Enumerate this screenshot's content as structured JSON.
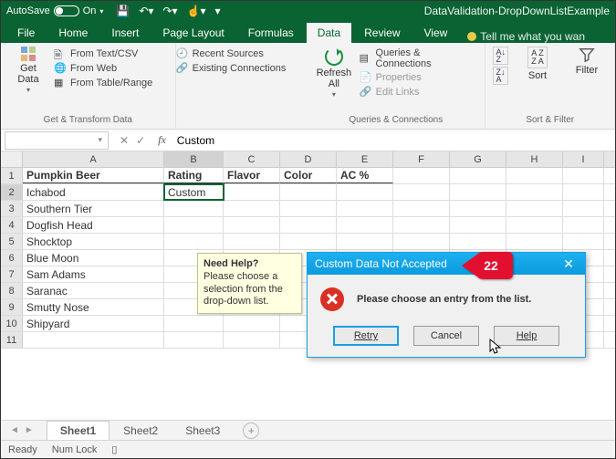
{
  "titlebar": {
    "autosave_label": "AutoSave",
    "autosave_state": "On",
    "doc_title": "DataValidation-DropDownListExample"
  },
  "tabs": {
    "file": "File",
    "home": "Home",
    "insert": "Insert",
    "pagelayout": "Page Layout",
    "formulas": "Formulas",
    "data": "Data",
    "review": "Review",
    "view": "View",
    "tell": "Tell me what you wan"
  },
  "ribbon": {
    "getdata": "Get\nData",
    "from_textcsv": "From Text/CSV",
    "from_web": "From Web",
    "from_table": "From Table/Range",
    "recent_sources": "Recent Sources",
    "existing_conn": "Existing Connections",
    "group1_label": "Get & Transform Data",
    "refresh": "Refresh\nAll",
    "queries": "Queries & Connections",
    "properties": "Properties",
    "editlinks": "Edit Links",
    "group2_label": "Queries & Connections",
    "sort": "Sort",
    "filter": "Filter",
    "group3_label": "Sort & Filter"
  },
  "formula": {
    "namebox": "",
    "fx": "fx",
    "value": "Custom"
  },
  "columns": [
    {
      "k": "A",
      "w": 155
    },
    {
      "k": "B",
      "w": 65
    },
    {
      "k": "C",
      "w": 62
    },
    {
      "k": "D",
      "w": 62
    },
    {
      "k": "E",
      "w": 62
    },
    {
      "k": "F",
      "w": 62
    },
    {
      "k": "G",
      "w": 62
    },
    {
      "k": "H",
      "w": 62
    },
    {
      "k": "I",
      "w": 45
    }
  ],
  "headers": {
    "A": "Pumpkin Beer",
    "B": "Rating",
    "C": "Flavor",
    "D": "Color",
    "E": "AC %"
  },
  "active": {
    "row": 2,
    "col": "B",
    "value": "Custom"
  },
  "rows": [
    {
      "n": 1
    },
    {
      "n": 2,
      "A": "Ichabod",
      "B": "Custom"
    },
    {
      "n": 3,
      "A": "Southern Tier"
    },
    {
      "n": 4,
      "A": "Dogfish Head"
    },
    {
      "n": 5,
      "A": "Shocktop"
    },
    {
      "n": 6,
      "A": "Blue Moon"
    },
    {
      "n": 7,
      "A": "Sam Adams"
    },
    {
      "n": 8,
      "A": "Saranac"
    },
    {
      "n": 9,
      "A": "Smutty Nose"
    },
    {
      "n": 10,
      "A": "Shipyard"
    },
    {
      "n": 11
    }
  ],
  "tip": {
    "title": "Need Help?",
    "body": "Please choose a selection from the drop-down list."
  },
  "dialog": {
    "title": "Custom Data Not Accepted",
    "message": "Please choose an entry from the list.",
    "retry": "Retry",
    "cancel": "Cancel",
    "help": "Help"
  },
  "marker": "22",
  "sheets": {
    "s1": "Sheet1",
    "s2": "Sheet2",
    "s3": "Sheet3"
  },
  "status": {
    "ready": "Ready",
    "numlock": "Num Lock"
  }
}
